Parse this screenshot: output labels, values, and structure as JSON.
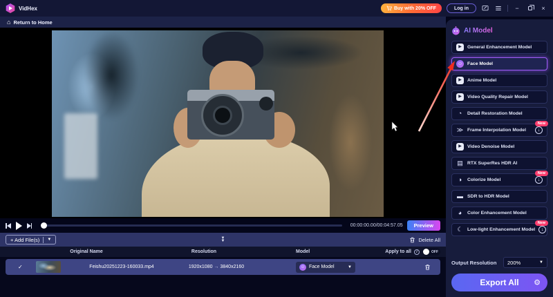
{
  "titlebar": {
    "app_name": "VidHex",
    "buy_label": "Buy with 20% OFF",
    "login_label": "Log in",
    "minimize": "−",
    "close": "×"
  },
  "nav": {
    "return_home": "Return to Home"
  },
  "player": {
    "time": "00:00:00.00/00:04:57.05",
    "preview_label": "Preview"
  },
  "toolbar": {
    "add_files": "+ Add File(s)",
    "delete_all": "Delete All"
  },
  "table": {
    "headers": {
      "name": "Original Name",
      "resolution": "Resolution",
      "model": "Model",
      "apply_to_all": "Apply to all",
      "toggle_state": "OFF"
    },
    "files": [
      {
        "checked": "✓",
        "name": "Feishu20251223-160033.mp4",
        "source_resolution": "1920x1080",
        "target_resolution": "3840x2160",
        "model": "Face Model"
      }
    ]
  },
  "sidebar": {
    "title": "AI Model",
    "models": [
      {
        "label": "General Enhancement Model",
        "icon": "video-enhance-icon",
        "glyph": "▶",
        "style": "boxed"
      },
      {
        "label": "Face Model",
        "icon": "face-icon",
        "glyph": "☺",
        "style": "face",
        "selected": true
      },
      {
        "label": "Anime Model",
        "icon": "anime-icon",
        "glyph": "▶",
        "style": "boxed"
      },
      {
        "label": "Video Quality Repair Model",
        "icon": "video-repair-icon",
        "glyph": "▶",
        "style": "boxed"
      },
      {
        "label": "Detail Restoration Model",
        "icon": "detail-restoration-icon",
        "glyph": "◔"
      },
      {
        "label": "Frame Interpolation Model",
        "icon": "frame-interpolation-icon",
        "glyph": "≫",
        "badge": "New",
        "download": true
      },
      {
        "label": "Video Denoise Model",
        "icon": "video-denoise-icon",
        "glyph": "▶",
        "style": "boxed"
      },
      {
        "label": "RTX SuperRes HDR AI",
        "icon": "rtx-icon",
        "glyph": "▤"
      },
      {
        "label": "Colorize Model",
        "icon": "colorize-icon",
        "glyph": "◑",
        "badge": "New",
        "download": true
      },
      {
        "label": "SDR to HDR Model",
        "icon": "sdr-to-hdr-icon",
        "glyph": "▬"
      },
      {
        "label": "Color Enhancement Model",
        "icon": "color-enhancement-icon",
        "glyph": "◕"
      },
      {
        "label": "Low-light Enhancement Model",
        "icon": "low-light-icon",
        "glyph": "☾",
        "badge": "New",
        "download": true
      }
    ],
    "output_resolution_label": "Output Resolution",
    "output_resolution_value": "200%",
    "export_label": "Export All"
  },
  "colors": {
    "accent": "#8b5cf6",
    "selected_border": "#a05df8",
    "new_badge": "#fb3e6e",
    "buy_gradient": [
      "#ffb23e",
      "#ff4545"
    ],
    "preview_gradient": [
      "#3b82f6",
      "#d946ef"
    ],
    "export_gradient": [
      "#5a67f2",
      "#7d55f3"
    ],
    "annotation_arrow": "#ef2c1e"
  }
}
